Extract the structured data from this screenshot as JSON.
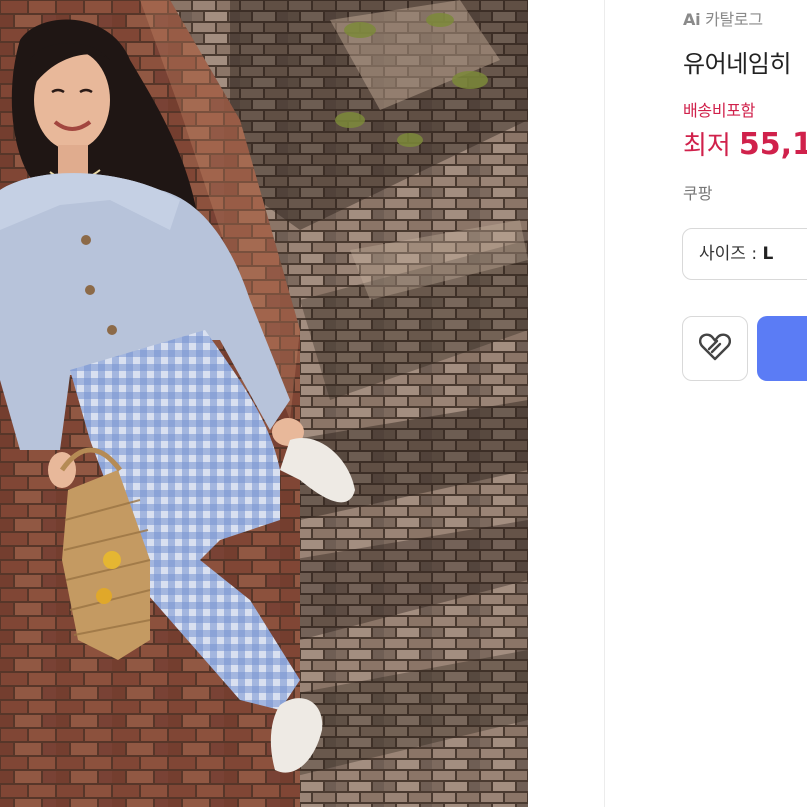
{
  "product": {
    "catalog_ai": "Ai",
    "catalog_label": "카탈로그",
    "title": "유어네임히",
    "shipping_note": "배송비포함",
    "price_prefix": "최저",
    "price_value": "55,1",
    "seller": "쿠팡"
  },
  "options": {
    "size_label": "사이즈 : ",
    "size_value": "L"
  },
  "actions": {
    "wish_icon": "heart-icon",
    "buy_color": "#5b7cf5"
  },
  "colors": {
    "price": "#d0214b",
    "accent": "#5b7cf5"
  }
}
